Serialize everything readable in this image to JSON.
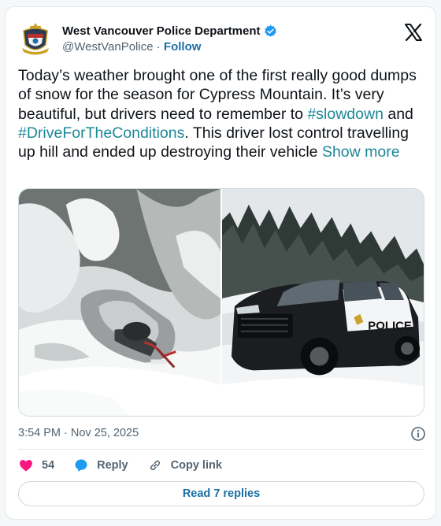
{
  "header": {
    "display_name": "West Vancouver Police Department",
    "handle": "@WestVanPolice",
    "separator": "·",
    "follow_label": "Follow"
  },
  "tweet": {
    "text_part1": "Today’s weather brought one of the first really good dumps of snow for the season for Cypress Mountain.  It’s very beautiful, but drivers need to remember to ",
    "hashtag1": "#slowdown",
    "text_part2": " and ",
    "hashtag2": "#DriveForTheConditions",
    "text_part3": ".  This driver lost control travelling up hill and ended up destroying their vehicle ",
    "show_more": "Show more"
  },
  "media": {
    "photo2_decal": "POLICE"
  },
  "meta": {
    "timestamp": "3:54 PM · Nov 25, 2025"
  },
  "actions": {
    "like_count": "54",
    "reply_label": "Reply",
    "copy_link_label": "Copy link"
  },
  "footer": {
    "read_replies": "Read 7 replies"
  },
  "colors": {
    "link": "#1d6fa5",
    "hashtag": "#1d8896",
    "heart": "#f91880",
    "reply_bubble": "#1d9bf0",
    "verified": "#1d9bf0"
  },
  "icons": [
    "police-crest-icon",
    "verified-badge-icon",
    "x-logo-icon",
    "info-icon",
    "heart-icon",
    "reply-bubble-icon",
    "link-icon"
  ]
}
